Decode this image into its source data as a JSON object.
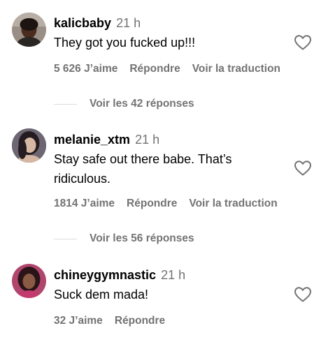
{
  "comments": [
    {
      "username": "kalicbaby",
      "time": "21 h",
      "text": "They got you fucked up!!!",
      "likes": "5 626 J’aime",
      "reply": "Répondre",
      "translate": "Voir la traduction",
      "replies": "Voir les 42 réponses"
    },
    {
      "username": "melanie_xtm",
      "time": "21 h",
      "text": "Stay safe out there babe. That’s ridiculous.",
      "likes": "1814 J’aime",
      "reply": "Répondre",
      "translate": "Voir la traduction",
      "replies": "Voir les 56 réponses"
    },
    {
      "username": "chineygymnastic",
      "time": "21 h",
      "text": "Suck dem mada!",
      "likes": "32 J’aime",
      "reply": "Répondre"
    }
  ],
  "icons": {
    "like": "heart-outline-icon"
  },
  "colors": {
    "text": "#000000",
    "secondary": "#737373",
    "divider": "#dbdbdb"
  }
}
